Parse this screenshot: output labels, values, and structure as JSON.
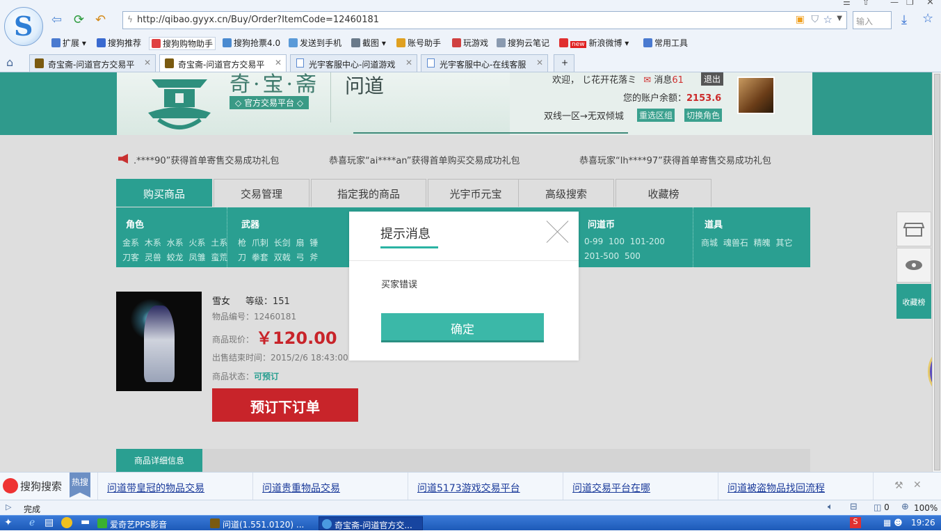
{
  "browser": {
    "url": "http://qibao.gyyx.cn/Buy/Order?ItemCode=12460181",
    "search_placeholder": "输入",
    "bookmarks": [
      "扩展",
      "搜狗推荐",
      "搜狗购物助手",
      "搜狗抢票4.0",
      "发送到手机",
      "截图",
      "账号助手",
      "玩游戏",
      "搜狗云笔记",
      "新浪微博",
      "常用工具"
    ],
    "bookmark_badge": "new",
    "tabs": [
      "奇宝斋-问道官方交易平",
      "奇宝斋-问道官方交易平",
      "光宇客服中心-问道游戏",
      "光宇客服中心-在线客服"
    ],
    "new_tab": "+"
  },
  "header": {
    "brand_title": "奇·宝·斋",
    "brand_subtitle": "◇ 官方交易平台 ◇",
    "game_logo": "问道",
    "welcome": "欢迎， じ花开花落ミ",
    "msg_label": "消息",
    "msg_count": "61",
    "logout": "退出",
    "balance_label": "您的账户余额：",
    "balance": "2153.6",
    "server": "双线一区→无双倾城",
    "reselect_server": "重选区组",
    "switch_role": "切换角色"
  },
  "ticker": [
    ".****90”获得首单寄售交易成功礼包",
    "恭喜玩家“ai****an”获得首单购买交易成功礼包",
    "恭喜玩家“lh****97”获得首单寄售交易成功礼包"
  ],
  "nav_tabs": [
    "购买商品",
    "交易管理",
    "指定我的商品",
    "光宇币元宝",
    "高级搜索",
    "收藏榜"
  ],
  "categories": {
    "role": {
      "title": "角色",
      "row1": "金系 木系 水系 火系 土系",
      "row2": "刀客 灵兽 蛟龙 凤雏 蛮荒"
    },
    "weapon": {
      "title": "武器",
      "row1": "枪 爪刺 长剑 扇 锤",
      "row2": "刀 拳套 双戟 弓 斧"
    },
    "coin": {
      "title": "问道币",
      "row1": "0-99 100 101-200",
      "row2": "201-500 500"
    },
    "item": {
      "title": "道具",
      "row1": "商城 魂兽石 精魄 其它"
    }
  },
  "product": {
    "name": "雪女",
    "level": "等级：151",
    "item_no": "物品编号：12460181",
    "price_label": "商品现价：",
    "price": "￥120.00",
    "end_time": "出售结束时间：2015/2/6 18:43:00",
    "status_label": "商品状态：",
    "status": "可预订",
    "order_button": "预订下订单"
  },
  "detail_tab": "商品详细信息",
  "side": {
    "favorites": "收藏榜"
  },
  "modal": {
    "title": "提示消息",
    "message": "买家错误",
    "ok": "确定"
  },
  "hotbar": {
    "brand": "搜狗搜索",
    "tag": "热搜",
    "links": [
      "问道带皇冠的物品交易",
      "问道贵重物品交易",
      "问道5173游戏交易平台",
      "问道交易平台在哪",
      "问道被盗物品找回流程"
    ]
  },
  "status": {
    "text": "完成",
    "zoom": "100%",
    "counter": "0"
  },
  "taskbar": {
    "items": [
      "爱奇艺PPS影音",
      "问道(1.551.0120) ...",
      "奇宝斋-问道官方交..."
    ],
    "clock": "19:26"
  },
  "colors": {
    "accent": "#2a9f91",
    "price": "#c8242a",
    "link": "#1a3a9a"
  }
}
